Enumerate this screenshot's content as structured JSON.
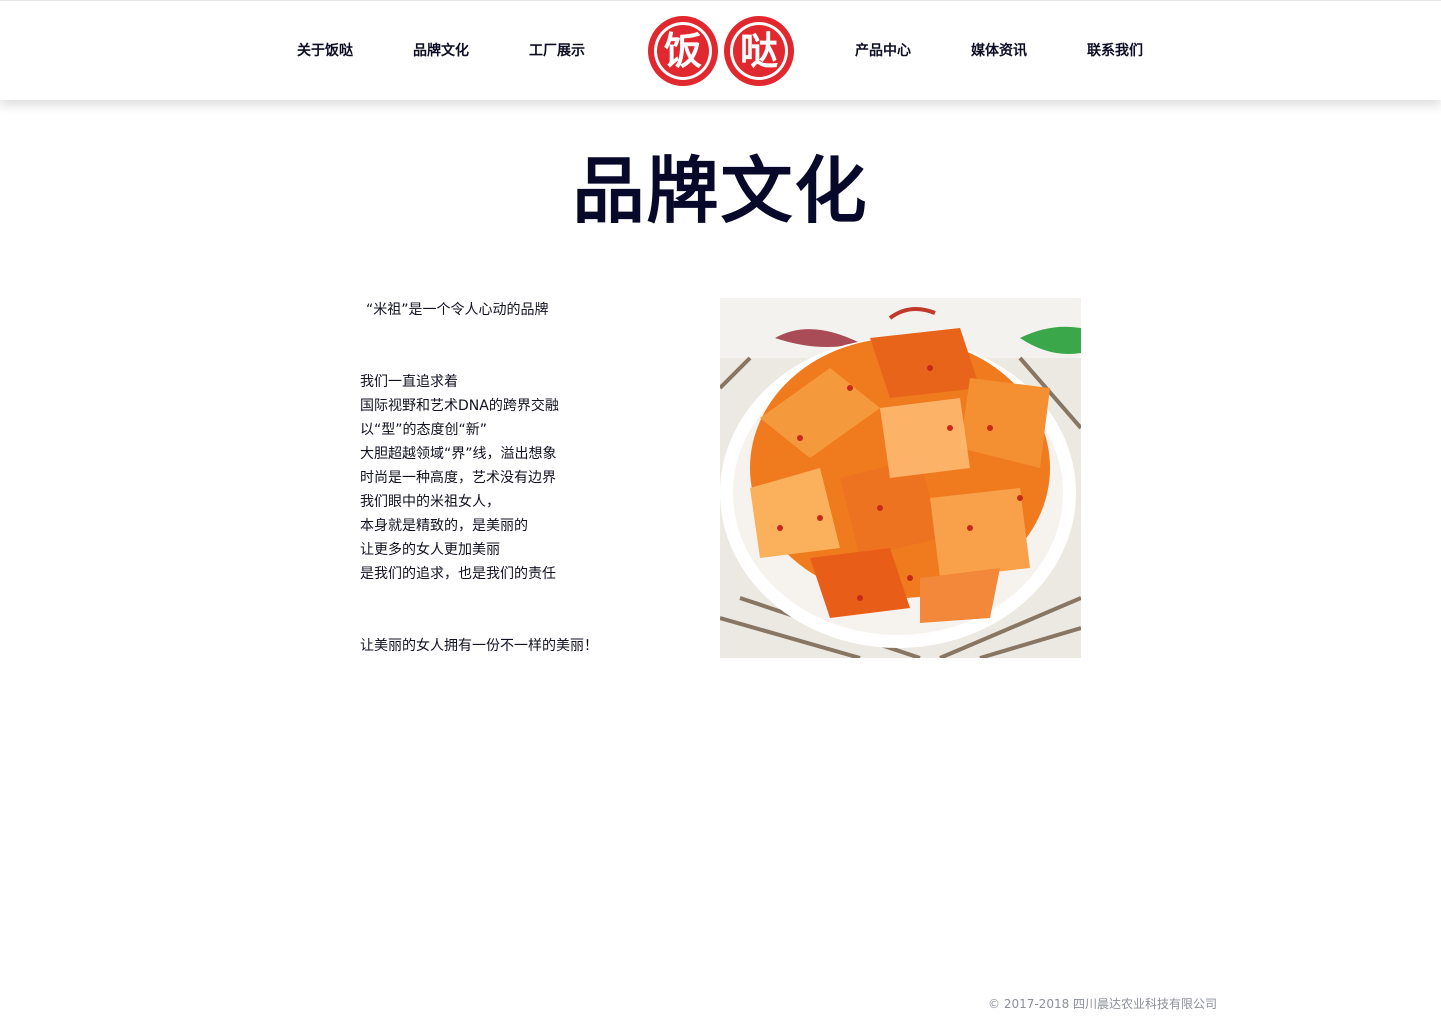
{
  "nav": {
    "left": [
      "关于饭哒",
      "品牌文化",
      "工厂展示"
    ],
    "right": [
      "产品中心",
      "媒体资讯",
      "联系我们"
    ]
  },
  "logo": {
    "chars": [
      "饭",
      "哒"
    ],
    "color": "#e0282e"
  },
  "main": {
    "title": "品牌文化",
    "intro": "“米祖”是一个令人心动的品牌",
    "paragraph": [
      "我们一直追求着",
      "国际视野和艺术DNA的跨界交融",
      "以“型”的态度创“新”",
      "大胆超越领域“界”线，溢出想象",
      "时尚是一种高度，艺术没有边界",
      "我们眼中的米祖女人，",
      "本身就是精致的，是美丽的",
      "让更多的女人更加美丽",
      "是我们的追求，也是我们的责任"
    ],
    "closing": "让美丽的女人拥有一份不一样的美丽！",
    "image_subject": "spicy-pickled-radish-dish"
  },
  "footer": {
    "copyright": "© 2017-2018 四川晨达农业科技有限公司"
  },
  "colors": {
    "title": "#08082a",
    "accent": "#e0282e",
    "footer": "#8a8f99"
  }
}
